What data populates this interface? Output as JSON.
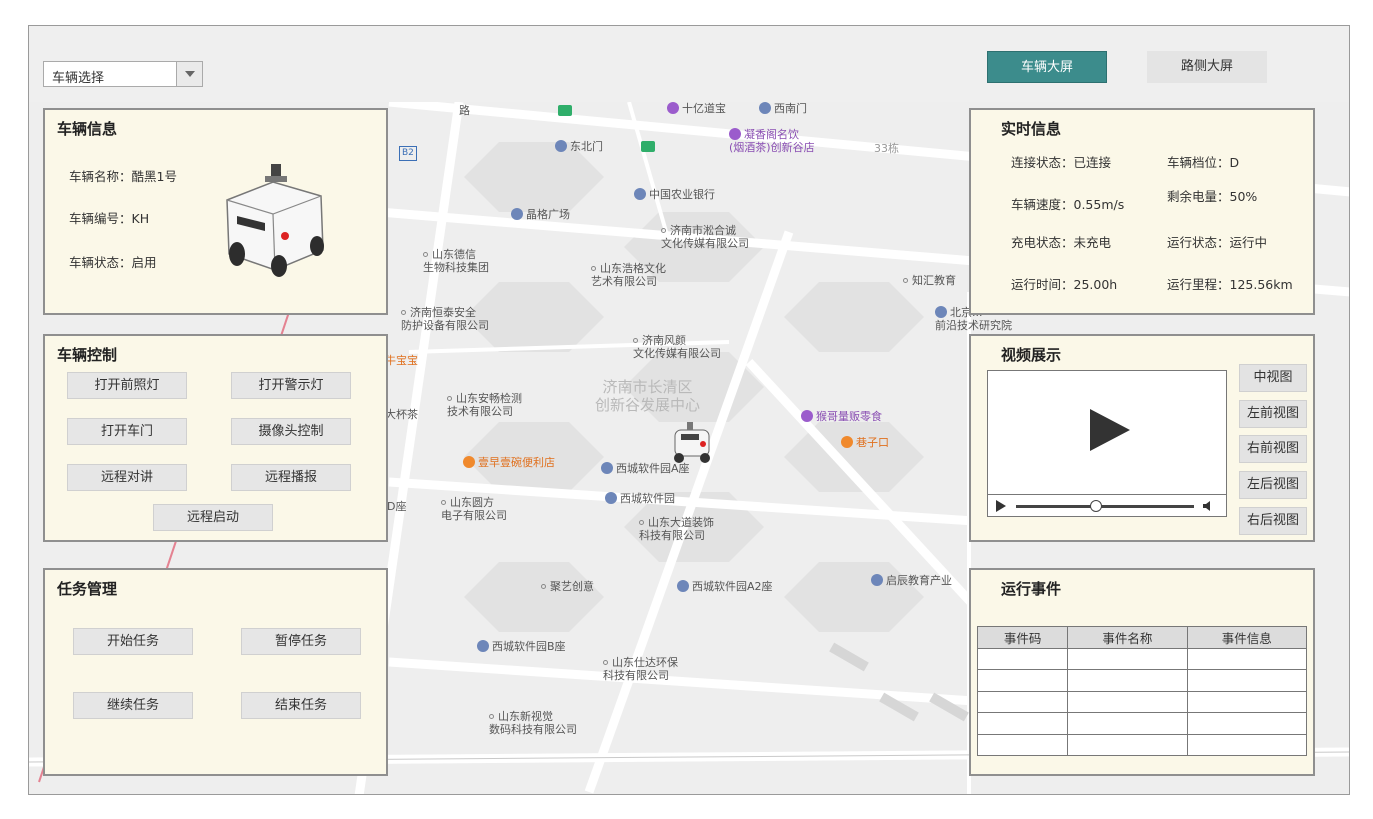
{
  "header": {
    "vehicle_select": "车辆选择",
    "tabs": [
      {
        "label": "车辆大屏",
        "active": true
      },
      {
        "label": "路侧大屏",
        "active": false
      }
    ]
  },
  "vehicle_info": {
    "title": "车辆信息",
    "name": "车辆名称：酷黑1号",
    "code": "车辆编号：KH",
    "status": "车辆状态：启用"
  },
  "vehicle_control": {
    "title": "车辆控制",
    "buttons": [
      "打开前照灯",
      "打开警示灯",
      "打开车门",
      "摄像头控制",
      "远程对讲",
      "远程播报",
      "远程启动"
    ]
  },
  "task_management": {
    "title": "任务管理",
    "buttons": [
      "开始任务",
      "暂停任务",
      "继续任务",
      "结束任务"
    ]
  },
  "realtime_info": {
    "title": "实时信息",
    "connection": "连接状态：已连接",
    "gear": "车辆档位：D",
    "speed": "车辆速度：0.55m/s",
    "battery": "剩余电量：50%",
    "charging": "充电状态：未充电",
    "run_status": "运行状态：运行中",
    "run_time": "运行时间：25.00h",
    "mileage": "运行里程：125.56km"
  },
  "video": {
    "title": "视频展示",
    "progress": 0.45,
    "views": [
      "中视图",
      "左前视图",
      "右前视图",
      "左后视图",
      "右后视图"
    ]
  },
  "events": {
    "title": "运行事件",
    "columns": [
      "事件码",
      "事件名称",
      "事件信息"
    ],
    "rows": 5
  },
  "map": {
    "pois": {
      "road": "路",
      "shiyi": "十亿道宝",
      "xinanmen": "西南门",
      "ningxiang": "凝香阁名饮\n(烟酒茶)创新谷店",
      "dongbeimen": "东北门",
      "building33": "33栋",
      "abc_bank": "中国农业银行",
      "jingge": "晶格广场",
      "jinan_songhe": "济南市淞合诚\n文化传媒有限公司",
      "desheng": "山东德信\n生物科技集团",
      "haoge": "山东浩格文化\n艺术有限公司",
      "zhihui": "知汇教育",
      "qianyan": "北京...\n前沿技术研究院",
      "hengtai": "济南恒泰安全\n防护设备有限公司",
      "fengyi": "济南风颜\n文化传媒有限公司",
      "niubao": "牛宝宝",
      "changqing": "济南市长清区\n创新谷发展中心",
      "dabeicha": "大杯茶",
      "anchang": "山东安畅检测\n技术有限公司",
      "hougeliang": "猴哥量贩零食",
      "xiangkou": "巷子口",
      "zaoyou": "壹早壹碗便利店",
      "xicheng_a": "西城软件园A座",
      "xicheng": "西城软件园",
      "yuanfang": "山东圆方\n电子有限公司",
      "dadao": "山东大道装饰\n科技有限公司",
      "dzuo": "D座",
      "juyi": "聚艺创意",
      "xicheng_a2": "西城软件园A2座",
      "qichen": "启辰教育产业",
      "xicheng_b": "西城软件园B座",
      "shida": "山东仕达环保\n科技有限公司",
      "xinshijue": "山东新视觉\n数码科技有限公司",
      "b2": "B2"
    }
  }
}
